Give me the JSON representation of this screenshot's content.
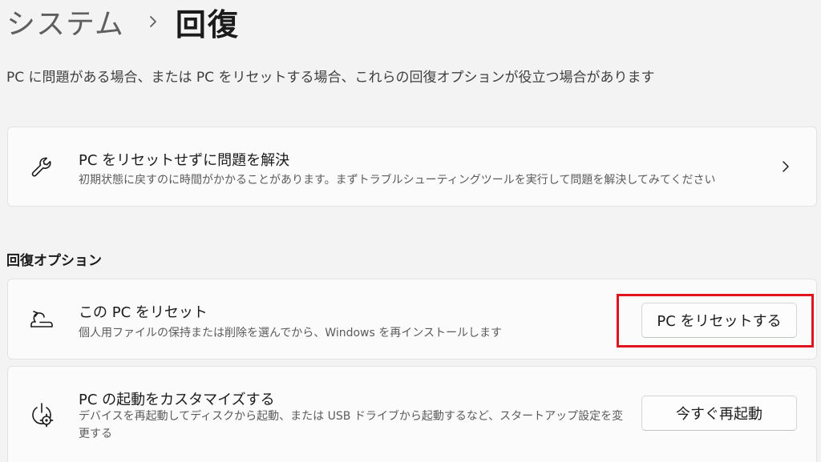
{
  "breadcrumb": {
    "parent": "システム",
    "current": "回復"
  },
  "page": {
    "description": "PC に問題がある場合、または PC をリセットする場合、これらの回復オプションが役立つ場合があります"
  },
  "troubleshoot": {
    "title": "PC をリセットせずに問題を解決",
    "subtitle": "初期状態に戻すのに時間がかかることがあります。まずトラブルシューティングツールを実行して問題を解決してみてください",
    "icon": "wrench-icon"
  },
  "recovery_options": {
    "heading": "回復オプション",
    "items": [
      {
        "title": "この PC をリセット",
        "subtitle": "個人用ファイルの保持または削除を選んでから、Windows を再インストールします",
        "button_label": "PC をリセットする",
        "icon": "reset-pc-icon"
      },
      {
        "title": "PC の起動をカスタマイズする",
        "subtitle": "デバイスを再起動してディスクから起動、または USB ドライブから起動するなど、スタートアップ設定を変更する",
        "button_label": "今すぐ再起動",
        "icon": "advanced-startup-icon"
      }
    ]
  },
  "colors": {
    "background": "#f3f3f3",
    "card": "#fbfbfb",
    "highlight": "#e0141e"
  }
}
